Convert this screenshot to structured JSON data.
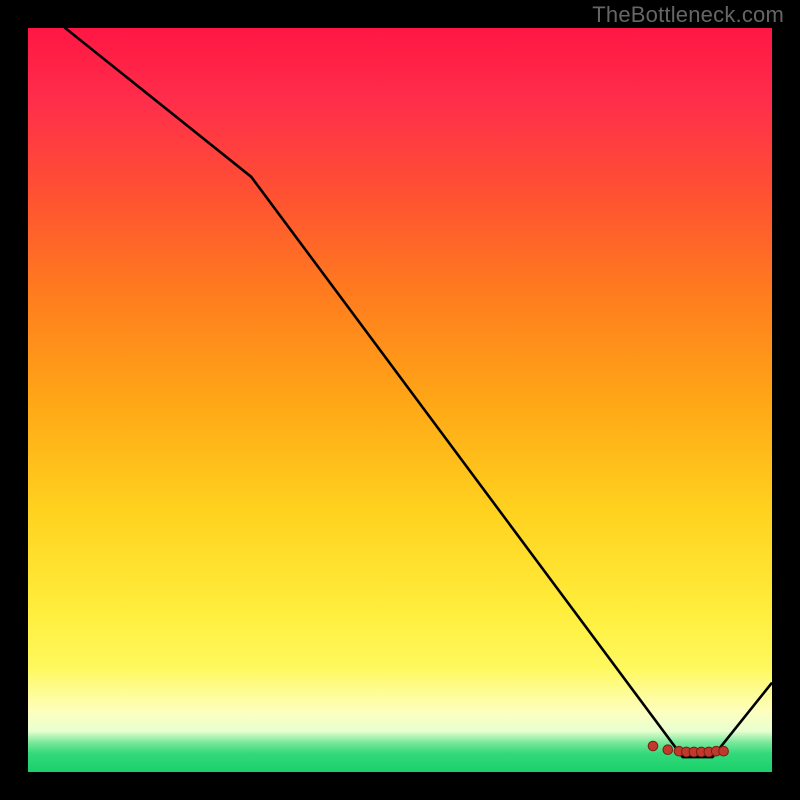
{
  "watermark": "TheBottleneck.com",
  "colors": {
    "background": "#000000",
    "line": "#000000",
    "marker": "#c0392b",
    "gradient_top": "#ff1744",
    "gradient_mid": "#ffd21f",
    "gradient_band": "#fdffc0",
    "gradient_bottom": "#1ad06a"
  },
  "chart_data": {
    "type": "line",
    "title": "",
    "xlabel": "",
    "ylabel": "",
    "xlim": [
      0,
      1
    ],
    "ylim": [
      0,
      1
    ],
    "grid": false,
    "legend": false,
    "x": [
      0.0,
      0.05,
      0.3,
      0.88,
      0.92,
      1.0
    ],
    "series": [
      {
        "name": "curve",
        "values": [
          1.05,
          1.0,
          0.8,
          0.02,
          0.02,
          0.12
        ]
      }
    ],
    "markers": {
      "x": [
        0.84,
        0.86,
        0.875,
        0.885,
        0.895,
        0.905,
        0.915,
        0.925,
        0.935
      ],
      "y": [
        0.035,
        0.03,
        0.028,
        0.027,
        0.027,
        0.027,
        0.027,
        0.028,
        0.028
      ]
    }
  }
}
